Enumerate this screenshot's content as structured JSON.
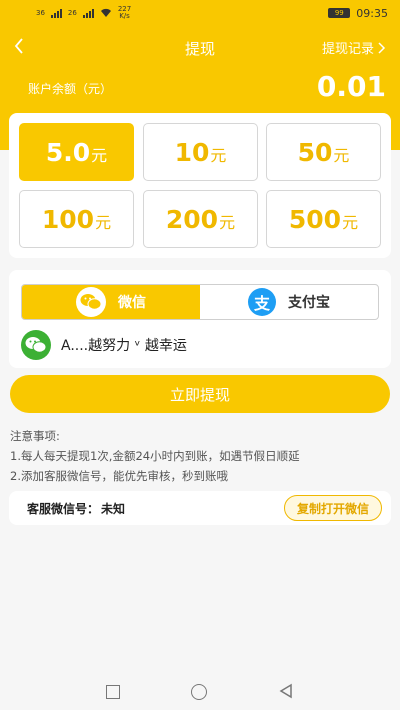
{
  "status_bar": {
    "signal_1": "36",
    "signal_2": "26",
    "speed_value": "227",
    "speed_unit": "K/s",
    "battery": "99",
    "time": "09:35"
  },
  "nav": {
    "back_icon": "chevron-left-icon",
    "title": "提现",
    "records": "提现记录",
    "records_icon": "chevron-right-icon"
  },
  "balance": {
    "label": "账户余额（元）",
    "value": "0.01"
  },
  "amounts": [
    {
      "num": "5.0",
      "unit": "元"
    },
    {
      "num": "10",
      "unit": "元"
    },
    {
      "num": "50",
      "unit": "元"
    },
    {
      "num": "100",
      "unit": "元"
    },
    {
      "num": "200",
      "unit": "元"
    },
    {
      "num": "500",
      "unit": "元"
    }
  ],
  "payment": {
    "wechat_label": "微信",
    "alipay_label": "支付宝",
    "alipay_glyph": "支",
    "account_name": "A....越努力 ᵛ 越幸运"
  },
  "withdraw_button": "立即提现",
  "notes": {
    "heading": "注意事项:",
    "line1": "1.每人每天提现1次,金额24小时内到账，如遇节假日顺延",
    "line2": "2.添加客服微信号，能优先审核，秒到账哦"
  },
  "service": {
    "label": "客服微信号：",
    "value": "未知",
    "copy_button": "复制打开微信"
  },
  "colors": {
    "accent": "#f9c800",
    "wechat_green": "#3cb034",
    "alipay_blue": "#1e9ef4"
  }
}
